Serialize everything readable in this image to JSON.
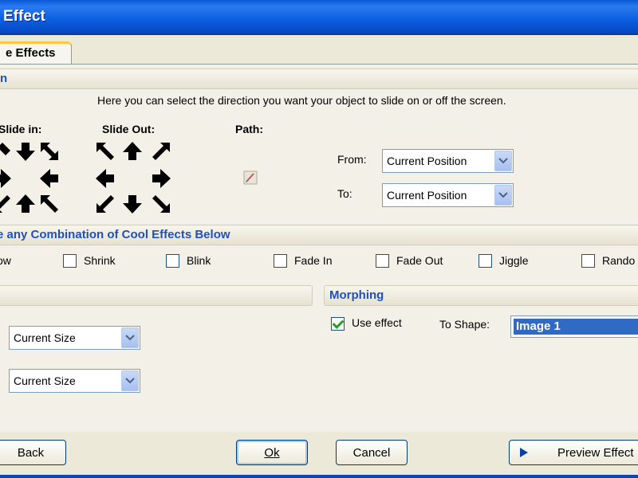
{
  "window": {
    "title": "Effect"
  },
  "tabs": [
    {
      "label": "e Effects"
    }
  ],
  "slide_section": {
    "title": "n",
    "description": "Here you can select the direction you want your object to slide on or off the screen.",
    "slide_in_label": "Slide in:",
    "slide_out_label": "Slide Out:",
    "path_label": "Path:",
    "from_label": "From:",
    "from_value": "Current Position",
    "to_label": "To:",
    "to_value": "Current Position"
  },
  "effects_section": {
    "title": "e any Combination of Cool Effects Below",
    "items": [
      {
        "label": "ow",
        "checked": false
      },
      {
        "label": "Shrink",
        "checked": false
      },
      {
        "label": "Blink",
        "checked": false
      },
      {
        "label": "Fade In",
        "checked": false
      },
      {
        "label": "Fade Out",
        "checked": false
      },
      {
        "label": "Jiggle",
        "checked": false
      },
      {
        "label": "Rando",
        "checked": false
      }
    ]
  },
  "size_section": {
    "combo1_value": "Current Size",
    "combo2_value": "Current Size"
  },
  "morphing_section": {
    "title": "Morphing",
    "use_effect_label": "Use effect",
    "use_effect_checked": true,
    "to_shape_label": "To Shape:",
    "to_shape_value": "Image 1"
  },
  "buttons": {
    "back": "Back",
    "ok": "Ok",
    "cancel": "Cancel",
    "preview": "Preview Effect"
  },
  "icons": {
    "arrow_color": "#000000",
    "dropdown": "chevron-down-icon",
    "path": "pencil-icon",
    "preview": "play-icon"
  },
  "colors": {
    "title_bar": "#0b5ee0",
    "group_title": "#2150b8",
    "selection": "#316ac5"
  }
}
